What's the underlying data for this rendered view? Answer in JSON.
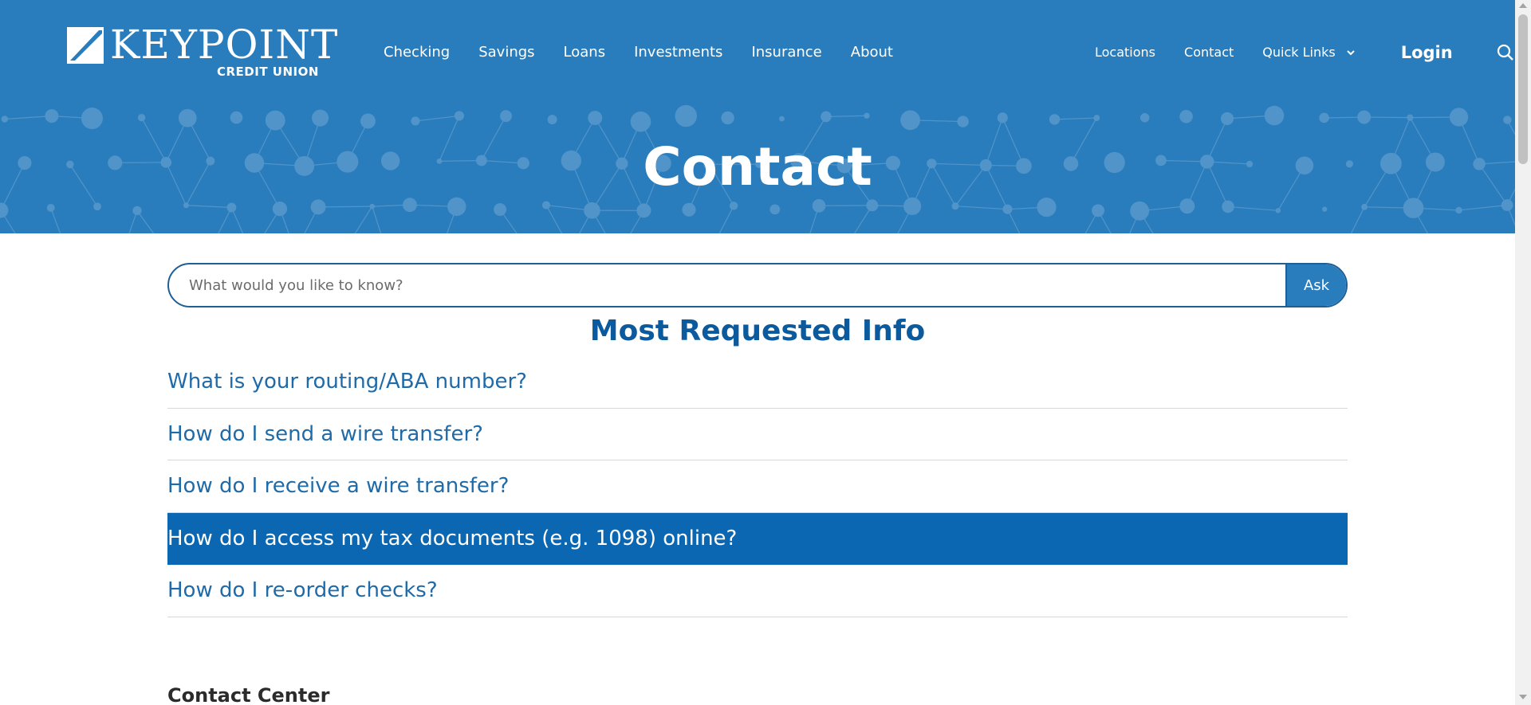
{
  "brand": {
    "logo_word": "KEYPOINT",
    "logo_sub": "CREDIT UNION"
  },
  "nav": {
    "main": [
      "Checking",
      "Savings",
      "Loans",
      "Investments",
      "Insurance",
      "About"
    ],
    "utility": [
      "Locations",
      "Contact"
    ],
    "quick_links": "Quick Links",
    "login": "Login"
  },
  "icons": {
    "search": "search-icon",
    "chevron": "chevron-down-icon",
    "logo_mark": "keypoint-logo-mark"
  },
  "hero": {
    "title": "Contact"
  },
  "ask": {
    "placeholder": "What would you like to know?",
    "button": "Ask"
  },
  "most_requested": {
    "title": "Most Requested Info",
    "items": [
      {
        "label": "What is your routing/ABA number?",
        "active": false
      },
      {
        "label": "How do I send a wire transfer?",
        "active": false
      },
      {
        "label": "How do I receive a wire transfer?",
        "active": false
      },
      {
        "label": "How do I access my tax documents (e.g. 1098) online?",
        "active": true
      },
      {
        "label": "How do I re-order checks?",
        "active": false
      }
    ]
  },
  "contact_center": {
    "heading": "Contact Center"
  },
  "colors": {
    "header_blue": "#2a7dbd",
    "title_blue": "#0c5a9e",
    "link_blue": "#1f6aa8",
    "active_blue": "#0b67b1"
  }
}
